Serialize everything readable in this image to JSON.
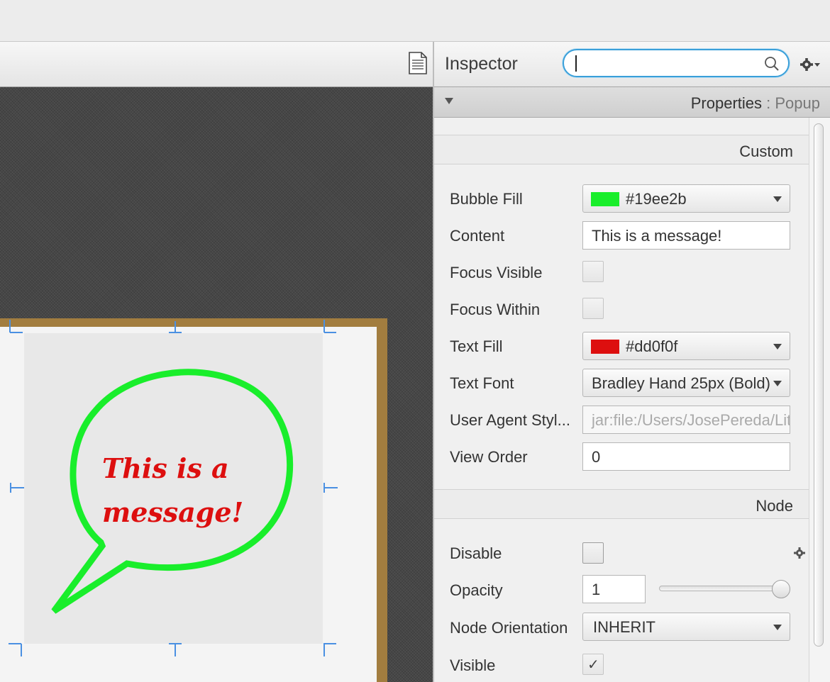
{
  "inspector": {
    "title": "Inspector",
    "search_value": "",
    "properties_label": "Properties",
    "properties_separator": " : ",
    "selected_type": "Popup"
  },
  "canvas": {
    "bubble_text": "This is a message!",
    "bubble_fill": "#19ee2b",
    "text_fill": "#dd0f0f"
  },
  "sections": {
    "custom": "Custom",
    "node": "Node"
  },
  "custom": {
    "bubble_fill_label": "Bubble Fill",
    "bubble_fill_value": "#19ee2b",
    "content_label": "Content",
    "content_value": "This is a message!",
    "focus_visible_label": "Focus Visible",
    "focus_visible_checked": false,
    "focus_within_label": "Focus Within",
    "focus_within_checked": false,
    "text_fill_label": "Text Fill",
    "text_fill_value": "#dd0f0f",
    "text_font_label": "Text Font",
    "text_font_value": "Bradley Hand 25px (Bold)",
    "user_agent_label": "User Agent Styl...",
    "user_agent_value": "jar:file:/Users/JosePereda/Lit",
    "view_order_label": "View Order",
    "view_order_value": "0"
  },
  "node": {
    "disable_label": "Disable",
    "disable_checked": false,
    "opacity_label": "Opacity",
    "opacity_value": "1",
    "opacity_slider": 1.0,
    "orientation_label": "Node Orientation",
    "orientation_value": "INHERIT",
    "visible_label": "Visible",
    "visible_checked": true,
    "visible_tick": "✓"
  }
}
